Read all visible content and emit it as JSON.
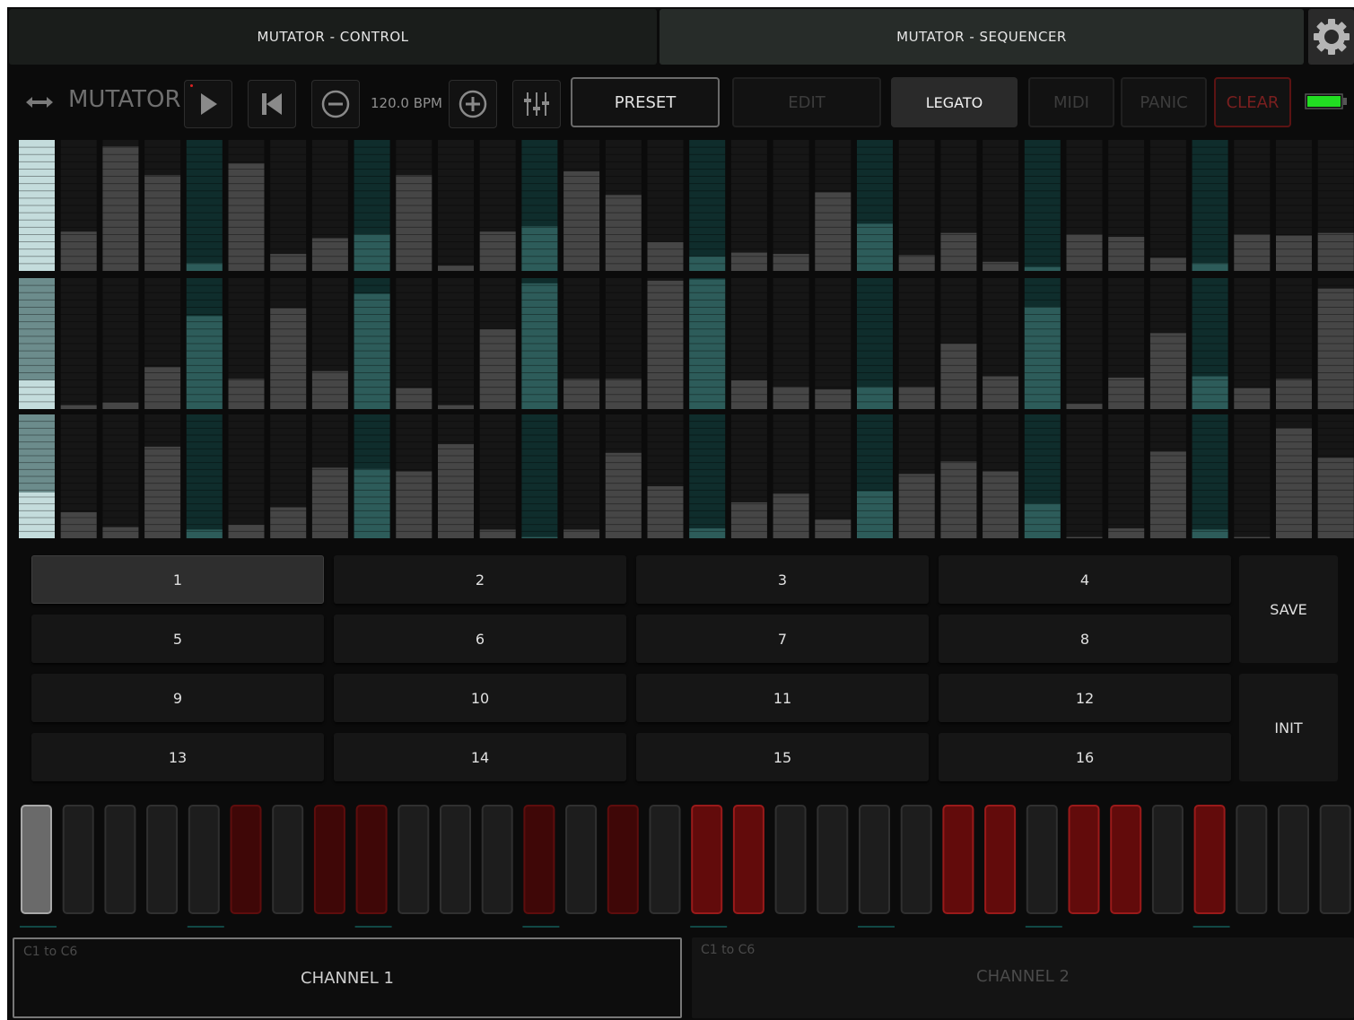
{
  "tabs": {
    "control": "MUTATOR - CONTROL",
    "sequencer": "MUTATOR - SEQUENCER"
  },
  "settings_icon": "gear-icon",
  "toolbar": {
    "resize_icon": "double-arrow-icon",
    "app_name": "MUTATOR",
    "play_icon": "play-icon",
    "rewind_icon": "skip-back-icon",
    "minus_icon": "minus-circle-icon",
    "bpm": "120.0 BPM",
    "plus_icon": "plus-circle-icon",
    "mixer_icon": "sliders-icon",
    "preset": "PRESET",
    "edit": "EDIT",
    "legato": "LEGATO",
    "midi": "MIDI",
    "panic": "PANIC",
    "clear": "CLEAR",
    "battery_icon": "battery-icon"
  },
  "colors": {
    "accent_teal": "#114845",
    "step_red": "#5e0d0d",
    "battery": "#22dd22"
  },
  "sequencer": {
    "current_step": 1,
    "highlight_steps": [
      1,
      5,
      9,
      13,
      17,
      21,
      25,
      29
    ],
    "rows": [
      {
        "name": "row-1",
        "values": [
          100,
          30,
          95,
          73,
          6,
          82,
          13,
          25,
          28,
          73,
          4,
          30,
          34,
          76,
          58,
          22,
          11,
          14,
          13,
          60,
          36,
          12,
          29,
          7,
          3,
          28,
          26,
          10,
          6,
          28,
          27,
          29
        ]
      },
      {
        "name": "row-2",
        "values": [
          22,
          3,
          5,
          32,
          71,
          23,
          77,
          29,
          88,
          16,
          3,
          61,
          96,
          23,
          23,
          98,
          99,
          22,
          17,
          15,
          17,
          17,
          50,
          25,
          78,
          4,
          24,
          58,
          25,
          16,
          23,
          92
        ]
      },
      {
        "name": "row-3",
        "values": [
          37,
          21,
          9,
          74,
          7,
          11,
          25,
          57,
          56,
          54,
          76,
          7,
          1,
          7,
          69,
          42,
          8,
          29,
          36,
          15,
          38,
          52,
          62,
          54,
          28,
          1,
          8,
          70,
          7,
          1,
          89,
          65
        ]
      }
    ]
  },
  "presets": {
    "pads": [
      "1",
      "2",
      "3",
      "4",
      "5",
      "6",
      "7",
      "8",
      "9",
      "10",
      "11",
      "12",
      "13",
      "14",
      "15",
      "16"
    ],
    "active": "1",
    "save": "SAVE",
    "init": "INIT"
  },
  "steps": {
    "states": [
      0,
      0,
      0,
      0,
      0,
      1,
      0,
      1,
      1,
      0,
      0,
      0,
      1,
      0,
      1,
      0,
      2,
      2,
      0,
      0,
      0,
      0,
      2,
      2,
      0,
      2,
      2,
      0,
      2,
      0,
      0,
      0
    ],
    "current": 1,
    "markers": [
      1,
      5,
      9,
      13,
      17,
      21,
      25,
      29
    ]
  },
  "channels": [
    {
      "range": "C1 to C6",
      "name": "CHANNEL 1",
      "selected": true
    },
    {
      "range": "C1 to C6",
      "name": "CHANNEL 2",
      "selected": false
    }
  ]
}
